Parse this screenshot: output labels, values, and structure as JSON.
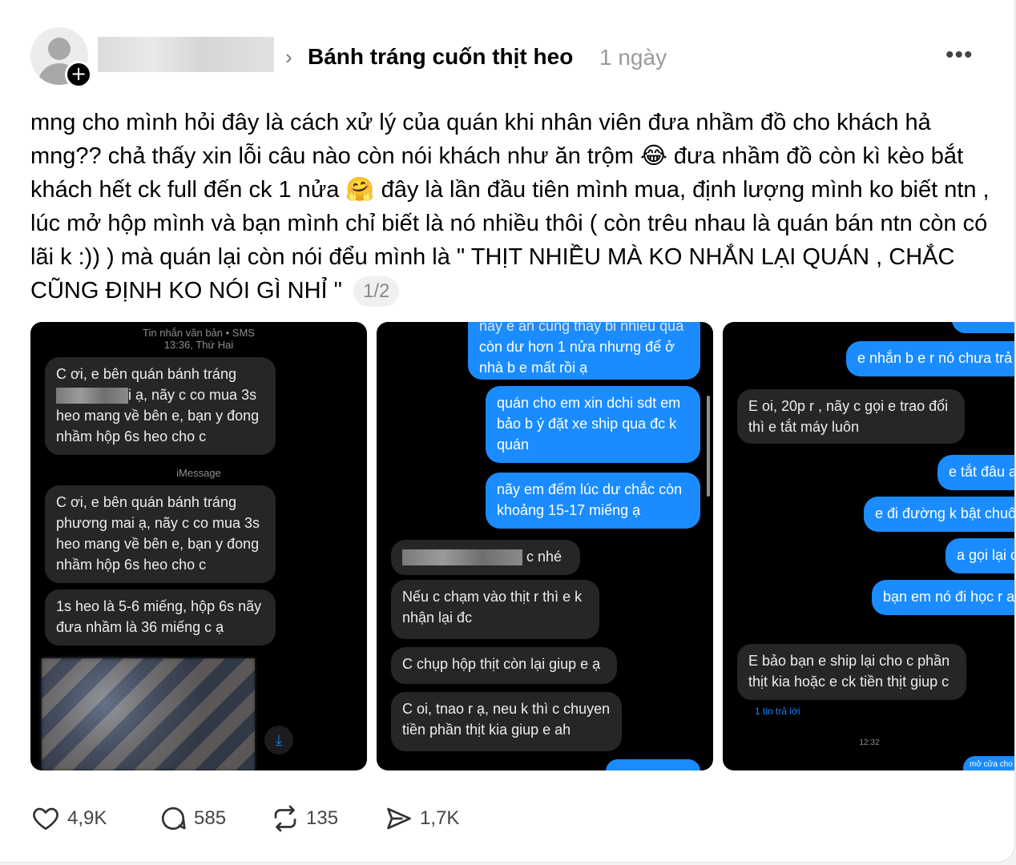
{
  "header": {
    "topic": "Bánh tráng cuốn thịt heo",
    "time": "1 ngày",
    "chevron": "›",
    "more": "•••",
    "follow": "+"
  },
  "post": {
    "text": "mng cho mình hỏi đây là cách xử lý của quán khi nhân viên đưa nhầm đồ cho khách hả mng?? chả thấy xin lỗi câu nào còn nói khách như ăn trộm 😂 đưa nhầm đồ còn kì kèo bắt khách hết ck full đến ck 1 nửa 🤗 đây là lần đầu tiên mình mua, định lượng mình ko biết ntn , lúc mở hộp mình và bạn mình chỉ biết là nó nhiều thôi ( còn trêu nhau là quán bán ntn còn có lãi k :)) ) mà quán lại còn nói đểu mình là \" THỊT NHIỀU MÀ KO NHẮN LẠI QUÁN , CHẮC CŨNG ĐỊNH KO NÓI GÌ NHỈ \"",
    "counter": "1/2"
  },
  "image1": {
    "header_line1": "Tin nhắn văn bản • SMS",
    "header_line2": "13:36, Thứ Hai",
    "msg1_a": "C ơi, e bên quán bánh tráng",
    "msg1_b": "i ạ, nãy c co mua 3s",
    "msg1_c": "heo mang về bên e, bạn y đong",
    "msg1_d": "nhầm hộp 6s heo cho c",
    "imessage": "iMessage",
    "msg2": "C ơi, e bên quán bánh tráng phương mai ạ, nãy c co mua 3s heo mang về bên e, bạn y đong nhầm hộp 6s heo cho c",
    "msg3": "1s heo là 5-6 miếng, hộp 6s nãy đưa nhầm là 36 miếng c ạ"
  },
  "image2": {
    "m1_top": "nay e an cung thay bi nhieu qua",
    "m1": "còn dư hơn 1 nửa nhưng để ở nhà b e mất rồi ạ",
    "m2": "quán cho em xin dchi sdt em bảo b ý đặt xe ship qua đc k quán",
    "m3": "nãy em đếm lúc dư chắc còn khoảng 15-17 miếng ạ",
    "g1": "c nhé",
    "g2": "Nếu c chạm vào thịt r thì e k nhận lại đc",
    "g3": "C chụp hộp thịt còn lại giup e ạ",
    "g4": "C oi, tnao r ạ, neu k thì c chuyen tiền phần thịt kia giup e ah"
  },
  "image3": {
    "b1": "e nhắn b e r nó chưa trả",
    "g1": "E oi, 20p r , nãy c gọi e trao đổi thì e tắt máy luôn",
    "b2": "e tắt đâu a",
    "b3": "e đi đường k bật chuô",
    "b4": "a gọi lại c",
    "b5": "bạn em nó đi học r a",
    "g2": "E bảo bạn e ship lại cho  c phần thịt kia hoặc e ck tiền thịt giup c",
    "reply": "1 tin trả lời",
    "time": "12:32",
    "b6": "mở cửa cho"
  },
  "actions": {
    "likes": "4,9K",
    "comments": "585",
    "reposts": "135",
    "shares": "1,7K"
  }
}
